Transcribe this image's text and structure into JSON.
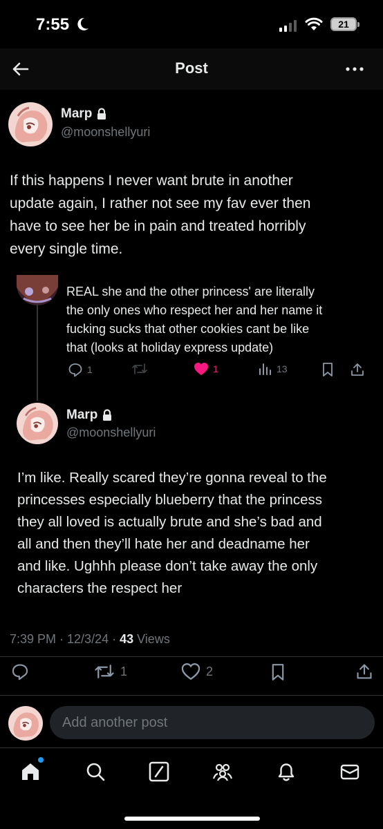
{
  "status_bar": {
    "time": "7:55",
    "battery": "21"
  },
  "header": {
    "title": "Post"
  },
  "main_post": {
    "display_name": "Marp",
    "handle": "@moonshellyuri",
    "text_lines": [
      "If this happens I never want brute in another",
      "update again, I rather not see my fav ever then",
      "have to see her be in pain and treated horribly",
      "every single time."
    ]
  },
  "reply_post": {
    "text_lines": [
      "REAL she and the other princess' are literally",
      "the only ones who respect her and her name it",
      "fucking sucks that other cookies cant be like",
      "that (looks at holiday express update)"
    ],
    "replies": "1",
    "likes": "1",
    "views": "13"
  },
  "focus_post": {
    "display_name": "Marp",
    "handle": "@moonshellyuri",
    "text_lines": [
      "I’m like. Really scared they’re gonna reveal to the",
      "princesses especially blueberry that the princess",
      "they all loved is actually brute and she’s bad and",
      "all and then they’ll hate her and deadname her",
      "and like. Ughhh please don’t take away the only",
      "characters the respect her"
    ],
    "timestamp": "7:39 PM · 12/3/24 · ",
    "views_count": "43",
    "views_label": " Views",
    "reposts": "1",
    "likes": "2"
  },
  "reply_bar": {
    "placeholder": "Add another post"
  },
  "colors": {
    "accent": "#1d9bf0",
    "like": "#f91880",
    "muted": "#71767b",
    "text": "#e7e9ea"
  },
  "icons": [
    "back-arrow-icon",
    "more-icon",
    "lock-icon",
    "reply-icon",
    "repost-icon",
    "like-icon",
    "views-icon",
    "bookmark-icon",
    "share-icon",
    "home-icon",
    "search-icon",
    "grok-icon",
    "communities-icon",
    "notifications-icon",
    "messages-icon"
  ]
}
